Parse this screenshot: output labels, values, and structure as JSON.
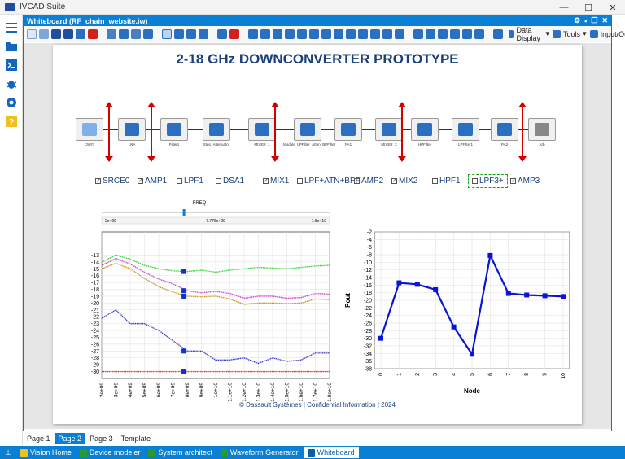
{
  "app": {
    "title": "IVCAD Suite"
  },
  "window_controls": {
    "minimize": "—",
    "maximize": "☐",
    "close": "✕"
  },
  "document": {
    "title": "Whiteboard (RF_chain_website.iw)"
  },
  "toolbar": {
    "data_display": "Data Display",
    "tools": "Tools",
    "io": "Input/Output"
  },
  "page": {
    "title": "2-18 GHz DOWNCONVERTER PROTOTYPE",
    "footer": "© Dassault Systèmes | Confidential Information | 2024"
  },
  "chain": {
    "blocks": [
      {
        "label": "CW#1"
      },
      {
        "label": "LNA"
      },
      {
        "label": "Filter1"
      },
      {
        "label": "Step_Attenuator"
      },
      {
        "label": "MIXER_1"
      },
      {
        "label": "Module_LPFilter_Atten_BPFilter"
      },
      {
        "label": "PA1"
      },
      {
        "label": "MIXER_2"
      },
      {
        "label": "HPFilter"
      },
      {
        "label": "LPFilter1"
      },
      {
        "label": "PA2"
      },
      {
        "label": "Arb"
      }
    ]
  },
  "checks": [
    {
      "label": "SRCE0",
      "checked": true
    },
    {
      "label": "AMP1",
      "checked": true
    },
    {
      "label": "LPF1",
      "checked": false
    },
    {
      "label": "DSA1",
      "checked": false
    },
    {
      "label": "MIX1",
      "checked": true
    },
    {
      "label": "LPF+ATN+BPF",
      "checked": false
    },
    {
      "label": "AMP2",
      "checked": false
    },
    {
      "label": "MIX2",
      "checked": true
    },
    {
      "label": "HPF1",
      "checked": false
    },
    {
      "label": "LPF3+",
      "checked": false
    },
    {
      "label": "AMP3",
      "checked": true
    }
  ],
  "slider": {
    "label": "FREQ",
    "min": "2e+09",
    "value": "7.776e+09",
    "max": "1.8e+10"
  },
  "chart_data": [
    {
      "type": "line",
      "xlabel": "FREQ",
      "ylabel": "",
      "x": [
        2000000000.0,
        3000000000.0,
        4000000000.0,
        5000000000.0,
        6000000000.0,
        7000000000.0,
        8000000000.0,
        9000000000.0,
        10000000000.0,
        11000000000.0,
        12000000000.0,
        13000000000.0,
        14000000000.0,
        15000000000.0,
        16000000000.0,
        17000000000.0,
        18000000000.0
      ],
      "xticks": [
        "2e+09",
        "3e+09",
        "4e+09",
        "5e+09",
        "6e+09",
        "7e+09",
        "8e+09",
        "9e+09",
        "1e+10",
        "1.1e+10",
        "1.2e+10",
        "1.3e+10",
        "1.4e+10",
        "1.5e+10",
        "1.6e+10",
        "1.7e+10",
        "1.8e+10"
      ],
      "ylim": [
        -31,
        -12
      ],
      "yticks": [
        -13,
        -14,
        -15,
        -16,
        -17,
        -18,
        -19,
        -20,
        -21,
        -22,
        -23,
        -24,
        -25,
        -26,
        -27,
        -28,
        -29,
        -30
      ],
      "cursor_x": 7776000000.0,
      "series": [
        {
          "color": "#3cd03c",
          "values": [
            -14.0,
            -13.0,
            -13.6,
            -14.5,
            -15.0,
            -15.3,
            -15.4,
            -15.2,
            -15.5,
            -15.2,
            -15.0,
            -14.8,
            -14.9,
            -15.0,
            -14.8,
            -14.6,
            -14.5
          ]
        },
        {
          "color": "#d040d0",
          "values": [
            -14.5,
            -13.5,
            -14.3,
            -15.5,
            -16.5,
            -17.2,
            -18.2,
            -18.5,
            -18.3,
            -18.6,
            -19.3,
            -19.0,
            -19.0,
            -19.3,
            -19.2,
            -18.6,
            -18.7
          ]
        },
        {
          "color": "#c89820",
          "values": [
            -15.0,
            -14.2,
            -15.0,
            -16.4,
            -17.6,
            -18.4,
            -19.0,
            -19.1,
            -19.0,
            -19.4,
            -20.2,
            -20.0,
            -20.0,
            -20.1,
            -20.0,
            -19.4,
            -19.5
          ]
        },
        {
          "color": "#3838c8",
          "values": [
            -22.2,
            -21.0,
            -23.0,
            -23.0,
            -24.0,
            -25.5,
            -27.0,
            -27.0,
            -28.3,
            -28.3,
            -28.0,
            -28.8,
            -28.0,
            -28.5,
            -28.3,
            -27.3,
            -27.3
          ]
        },
        {
          "color": "#e03030",
          "values": [
            -30.0,
            -30.0,
            -30.0,
            -30.0,
            -30.0,
            -30.0,
            -30.0,
            -30.0,
            -30.0,
            -30.0,
            -30.0,
            -30.0,
            -30.0,
            -30.0,
            -30.0,
            -30.0,
            -30.0
          ]
        }
      ],
      "markers": [
        -15.4,
        -18.2,
        -19.0,
        -27.0,
        -30.0
      ]
    },
    {
      "type": "line",
      "xlabel": "Node",
      "ylabel": "Pout",
      "x": [
        0,
        1,
        2,
        3,
        4,
        5,
        6,
        7,
        8,
        9,
        10
      ],
      "ylim": [
        -38,
        -2
      ],
      "yticks": [
        -2,
        -4,
        -6,
        -8,
        -10,
        -12,
        -14,
        -16,
        -18,
        -20,
        -22,
        -24,
        -26,
        -28,
        -30,
        -32,
        -34,
        -36,
        -38
      ],
      "series": [
        {
          "color": "#0a14d8",
          "values": [
            -30.0,
            -15.4,
            -15.8,
            -17.2,
            -27.0,
            -34.2,
            -8.2,
            -18.2,
            -18.6,
            -18.8,
            -19.0
          ]
        }
      ]
    }
  ],
  "page_tabs": [
    "Page 1",
    "Page 2",
    "Page 3",
    "Template"
  ],
  "active_page_tab": "Page 2",
  "taskbar": {
    "pin": "⊥",
    "items": [
      "Vision Home",
      "Device modeler",
      "System architect",
      "Waveform Generator",
      "Whiteboard"
    ],
    "active": "Whiteboard"
  },
  "colors": {
    "accent": "#0a7fd6",
    "title": "#1a3f7a",
    "marker": "#d40000"
  }
}
